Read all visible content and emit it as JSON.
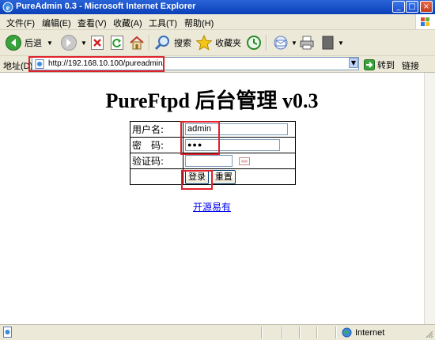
{
  "window": {
    "title": "PureAdmin 0.3 - Microsoft Internet Explorer"
  },
  "menu": {
    "items": [
      "文件(F)",
      "编辑(E)",
      "查看(V)",
      "收藏(A)",
      "工具(T)",
      "帮助(H)"
    ]
  },
  "toolbar": {
    "back_label": "后退",
    "search_label": "搜索",
    "favorites_label": "收藏夹"
  },
  "address": {
    "label": "地址(D)",
    "url": "http://192.168.10.100/pureadmin/",
    "go_label": "转到",
    "links_label": "链接"
  },
  "page": {
    "heading": "PureFtpd 后台管理  v0.3",
    "username_label": "用户名:",
    "username_value": "admin",
    "password_label": "密　码:",
    "password_value": "●●●",
    "captcha_label": "验证码:",
    "login_button": "登录",
    "reset_button": "重置",
    "footer_link": "开源易有"
  },
  "status": {
    "zone": "Internet"
  },
  "colors": {
    "highlight": "#e0222a",
    "link": "#0000ee",
    "chrome": "#ece9d8",
    "titlebar": "#0a3fb8"
  }
}
